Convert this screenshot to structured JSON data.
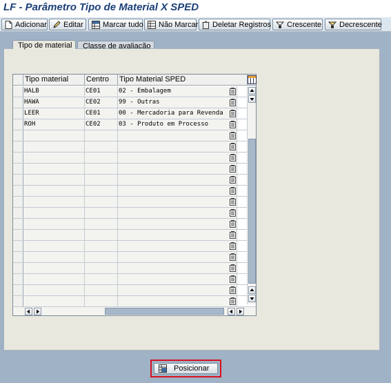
{
  "window": {
    "title": "LF - Parâmetro Tipo de Material X SPED"
  },
  "toolbar": {
    "buttons": [
      {
        "label": "Adicionar",
        "icon": "new-document-icon"
      },
      {
        "label": "Editar",
        "icon": "pencil-icon"
      },
      {
        "label": "Marcar tudo",
        "icon": "select-all-icon"
      },
      {
        "label": "Não Marcar",
        "icon": "deselect-all-icon"
      },
      {
        "label": "Deletar Registros",
        "icon": "trash-icon"
      },
      {
        "label": "Crescente",
        "icon": "sort-ascending-icon"
      },
      {
        "label": "Decrescente",
        "icon": "sort-descending-icon"
      }
    ]
  },
  "tabs": [
    {
      "label": "Tipo de material",
      "active": true
    },
    {
      "label": "Classe de avaliação",
      "active": false
    }
  ],
  "table": {
    "columns": [
      "Tipo material",
      "Centro",
      "Tipo Material SPED"
    ],
    "rows": [
      [
        "HALB",
        "CE01",
        "02 - Embalagem"
      ],
      [
        "HAWA",
        "CE02",
        "99 - Outras"
      ],
      [
        "LEER",
        "CE01",
        "00 - Mercadoria para Revenda"
      ],
      [
        "ROH",
        "CE02",
        "03 - Produto em Processo"
      ]
    ],
    "empty_rows": 16
  },
  "footer": {
    "position_button_label": "Posicionar",
    "position_icon": "position-icon"
  },
  "colors": {
    "title": "#1b3f79",
    "background": "#9fb2c6",
    "highlight": "#d8101f"
  }
}
